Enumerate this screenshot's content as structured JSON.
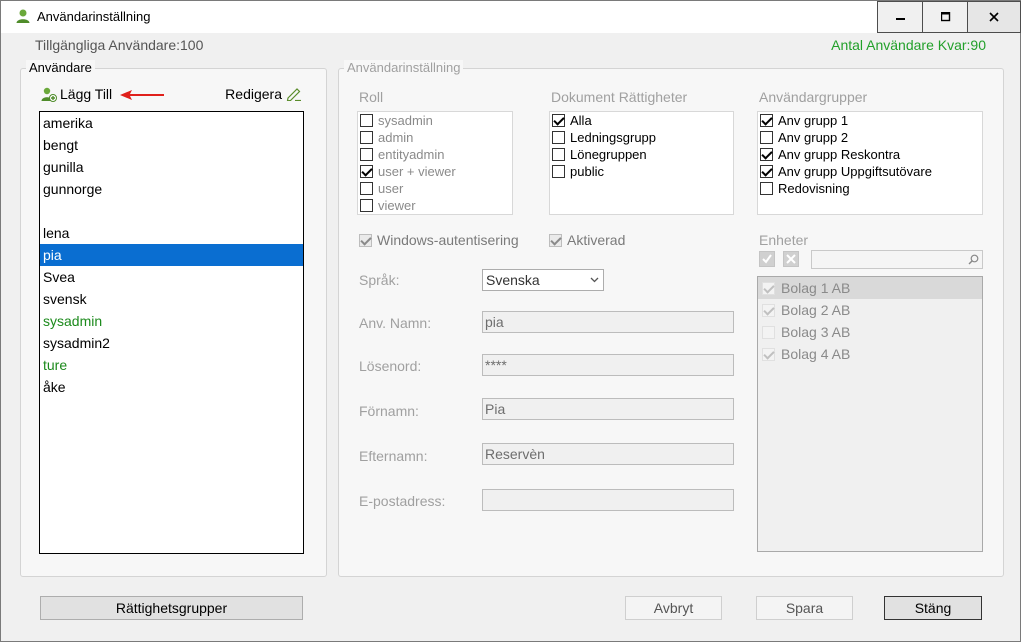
{
  "window": {
    "title": "Användarinställning",
    "icon": "user-icon"
  },
  "info": {
    "available_users": "Tillgängliga Användare:100",
    "remaining_users": "Antal Användare Kvar:90"
  },
  "users_panel": {
    "title": "Användare",
    "add_label": "Lägg Till",
    "edit_label": "Redigera",
    "users": [
      {
        "name": "amerika",
        "color": "#000000"
      },
      {
        "name": "bengt",
        "color": "#000000"
      },
      {
        "name": "gunilla",
        "color": "#000000"
      },
      {
        "name": "gunnorge",
        "color": "#000000"
      },
      {
        "name": "",
        "color": "#000000"
      },
      {
        "name": "lena",
        "color": "#000000"
      },
      {
        "name": "pia",
        "color": "#ffffff",
        "selected": true
      },
      {
        "name": "Svea",
        "color": "#000000"
      },
      {
        "name": "svensk",
        "color": "#000000"
      },
      {
        "name": "sysadmin",
        "color": "#1c8a1c"
      },
      {
        "name": "sysadmin2",
        "color": "#000000"
      },
      {
        "name": "ture",
        "color": "#1c8a1c"
      },
      {
        "name": "åke",
        "color": "#000000"
      }
    ]
  },
  "settings": {
    "title": "Användarinställning",
    "role": {
      "label": "Roll",
      "items": [
        {
          "label": "sysadmin",
          "checked": false
        },
        {
          "label": "admin",
          "checked": false
        },
        {
          "label": "entityadmin",
          "checked": false
        },
        {
          "label": "user + viewer",
          "checked": true
        },
        {
          "label": "user",
          "checked": false
        },
        {
          "label": "viewer",
          "checked": false
        }
      ]
    },
    "doc_rights": {
      "label": "Dokument Rättigheter",
      "items": [
        {
          "label": "Alla",
          "checked": true
        },
        {
          "label": "Ledningsgrupp",
          "checked": false
        },
        {
          "label": "Lönegruppen",
          "checked": false
        },
        {
          "label": "public",
          "checked": false
        }
      ]
    },
    "user_groups": {
      "label": "Användargrupper",
      "items": [
        {
          "label": "Anv grupp 1",
          "checked": true
        },
        {
          "label": "Anv grupp 2",
          "checked": false
        },
        {
          "label": "Anv grupp Reskontra",
          "checked": true
        },
        {
          "label": "Anv grupp Uppgiftsutövare",
          "checked": true
        },
        {
          "label": "Redovisning",
          "checked": false
        }
      ]
    },
    "windows_auth": {
      "label": "Windows-autentisering",
      "checked": true
    },
    "activated": {
      "label": "Aktiverad",
      "checked": true
    },
    "language": {
      "label": "Språk:",
      "value": "Svenska"
    },
    "username": {
      "label": "Anv. Namn:",
      "value": "pia"
    },
    "password": {
      "label": "Lösenord:",
      "value": "****"
    },
    "first_name": {
      "label": "Förnamn:",
      "value": "Pia"
    },
    "last_name": {
      "label": "Efternamn:",
      "value": "Reservèn"
    },
    "email": {
      "label": "E-postadress:",
      "value": ""
    },
    "entities": {
      "label": "Enheter",
      "items": [
        {
          "label": "Bolag 1 AB",
          "checked": true
        },
        {
          "label": "Bolag 2 AB",
          "checked": true
        },
        {
          "label": "Bolag 3 AB",
          "checked": false
        },
        {
          "label": "Bolag 4 AB",
          "checked": true
        }
      ]
    }
  },
  "buttons": {
    "permission_groups": "Rättighetsgrupper",
    "cancel": "Avbryt",
    "save": "Spara",
    "close": "Stäng"
  },
  "colors": {
    "selection": "#0a6ed1",
    "green_text": "#1c8a1c",
    "remaining_text": "#22a02a",
    "arrow": "#e0201b"
  }
}
